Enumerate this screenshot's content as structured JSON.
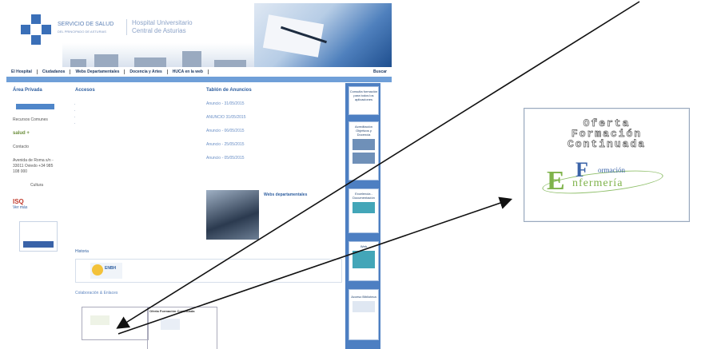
{
  "header": {
    "org_name": "SERVICIO DE SALUD",
    "org_sub": "DEL PRINCIPADO DE ASTURIAS",
    "hospital_line1": "Hospital Universitario",
    "hospital_line2": "Central de Asturias"
  },
  "nav": {
    "items": [
      "El Hospital",
      "Ciudadanos",
      "Webs Departamentales",
      "Docencia y Artes",
      "HUCA en la web"
    ],
    "right": "Buscar"
  },
  "left_column": {
    "heading": "Área Privada",
    "recursos": "Recursos Comunes",
    "sello": "salud +",
    "contacto": "Contacto",
    "address": "Avenida de Roma s/n - 33011 Oviedo +34 985 108 000",
    "cultura": "Cultura",
    "isq": "ISQ",
    "isq_sub": "Ver más"
  },
  "center_column": {
    "heading": "Accesos",
    "items": [
      "",
      "",
      "",
      ""
    ]
  },
  "tablon": {
    "heading": "Tablón de Anuncios",
    "items": [
      {
        "text": "Anuncio - 31/05/2015"
      },
      {
        "text": "ANUNCIO 31/05/2015"
      },
      {
        "text": "Anuncio - 06/05/2015"
      },
      {
        "text": "Anuncio - 25/05/2015"
      },
      {
        "text": "Anuncio - 05/05/2015"
      }
    ]
  },
  "news": {
    "title": "Webs departamentales",
    "lines": [
      "",
      "",
      "",
      "",
      ""
    ]
  },
  "historia": {
    "heading": "Historia",
    "brand": "ENBH",
    "text": ""
  },
  "colab_heading": "Colaboración & Enlaces",
  "footer_box1": "",
  "footer_box2": "Oferta Formación Continuada",
  "right_sidebar": {
    "boxes": [
      "Consulta formación para todos los aplicaciones",
      "Acreditación Objetivos y Docencia",
      "Excelencia - Documentación",
      "Web",
      "Acceso Biblioteca"
    ]
  },
  "zoom_card": {
    "title_line1": "Oferta",
    "title_line2": "Formación",
    "title_line3": "Continuada",
    "logo_F": "F",
    "logo_E": "E",
    "logo_small": "ormación",
    "logo_word": "nfermería"
  },
  "colors": {
    "accent": "#4d7fc2",
    "bar": "#6f9fd8",
    "green": "#7fb34b"
  }
}
